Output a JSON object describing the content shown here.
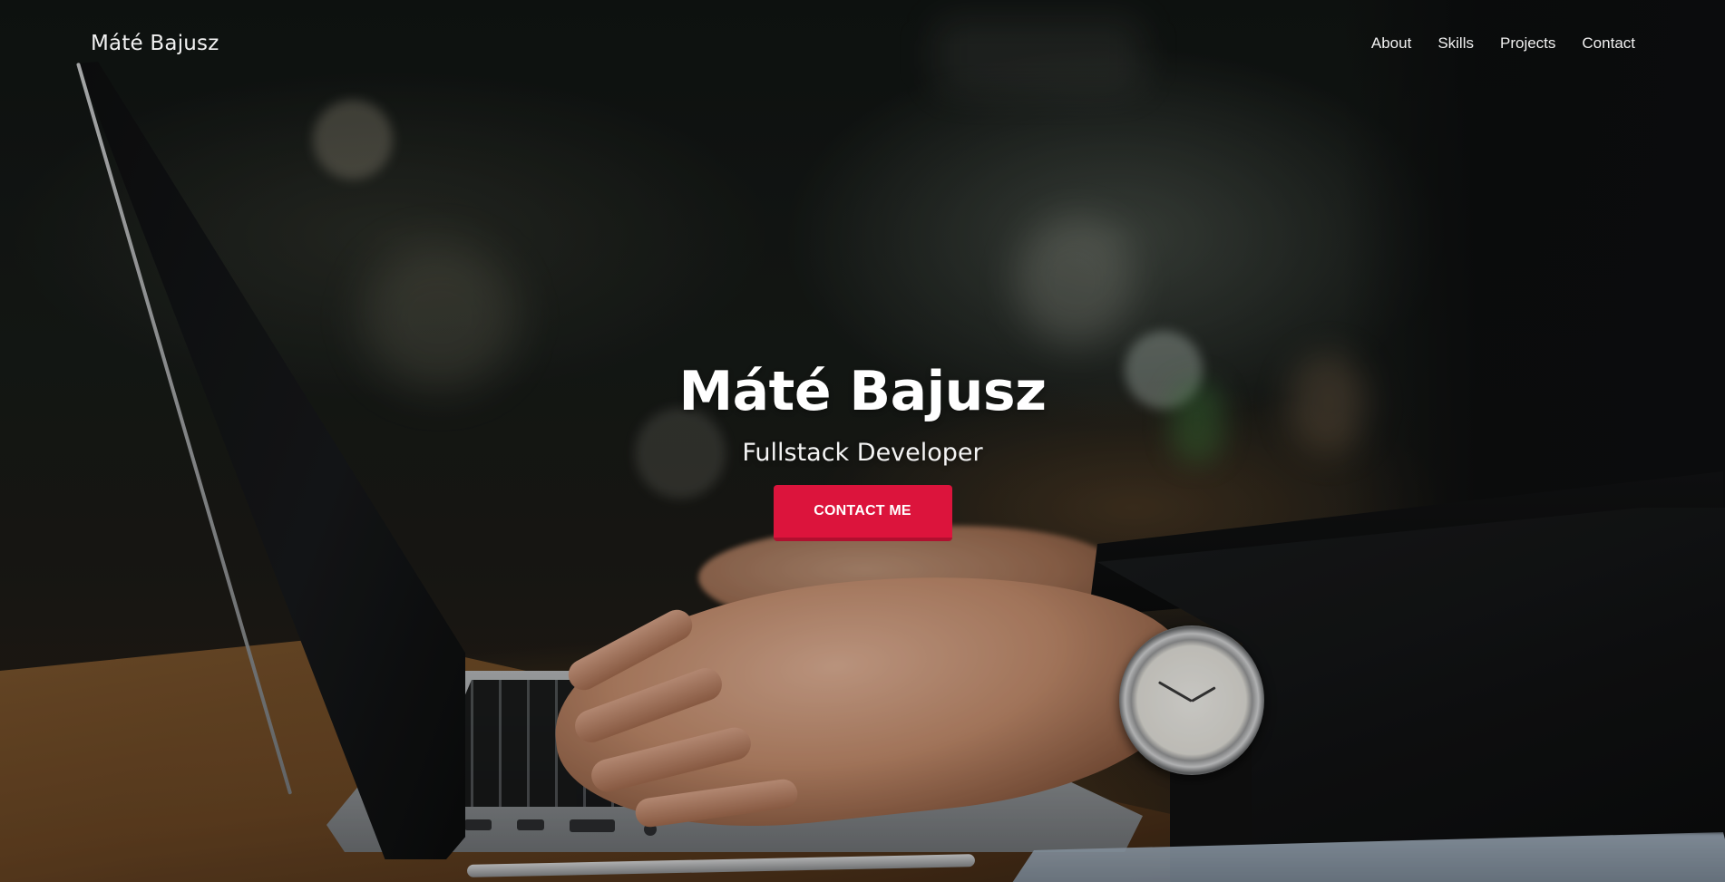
{
  "nav": {
    "brand": "Máté Bajusz",
    "links": [
      {
        "label": "About"
      },
      {
        "label": "Skills"
      },
      {
        "label": "Projects"
      },
      {
        "label": "Contact"
      }
    ]
  },
  "hero": {
    "title": "Máté Bajusz",
    "subtitle": "Fullstack Developer",
    "cta_label": "CONTACT ME"
  },
  "colors": {
    "accent": "#dc143c",
    "text": "#ffffff"
  }
}
